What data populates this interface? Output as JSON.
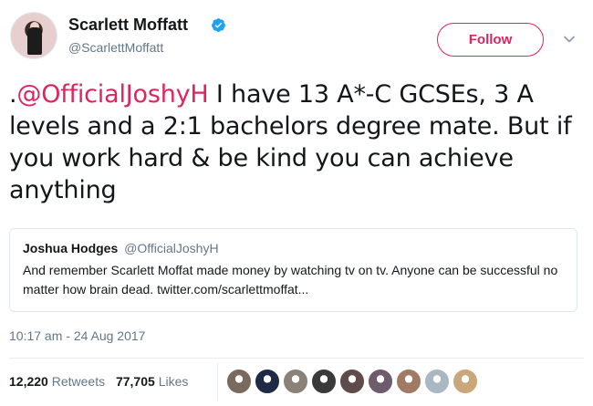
{
  "user": {
    "name": "Scarlett Moffatt",
    "handle": "@ScarlettMoffatt",
    "verified_icon": "verified-badge-icon",
    "avatar_icon": "profile-avatar"
  },
  "actions": {
    "follow_label": "Follow",
    "more_icon": "chevron-down-icon"
  },
  "tweet": {
    "prefix": ".",
    "mention": "@OfficialJoshyH",
    "text": " I have 13 A*-C GCSEs, 3 A levels and a 2:1 bachelors degree mate. But if you work hard & be kind you can achieve anything"
  },
  "quoted": {
    "name": "Joshua Hodges",
    "handle": "@OfficialJoshyH",
    "text": "And remember Scarlett Moffat made money by watching tv on tv. Anyone can be successful no matter how brain dead. twitter.com/scarlettmoffat..."
  },
  "timestamp": "10:17 am - 24 Aug 2017",
  "stats": {
    "retweets_count": "12,220",
    "retweets_label": "Retweets",
    "likes_count": "77,705",
    "likes_label": "Likes"
  },
  "colors": {
    "accent": "#e0245e",
    "verified": "#1da1f2",
    "secondary_text": "#657786"
  },
  "likers": [
    {
      "name": "liker-avatar-1",
      "color": "#7a6a5e"
    },
    {
      "name": "liker-avatar-2",
      "color": "#1f2a44"
    },
    {
      "name": "liker-avatar-3",
      "color": "#8a8178"
    },
    {
      "name": "liker-avatar-4",
      "color": "#3b3a3a"
    },
    {
      "name": "liker-avatar-5",
      "color": "#5d4c4a"
    },
    {
      "name": "liker-avatar-6",
      "color": "#6e5c6c"
    },
    {
      "name": "liker-avatar-7",
      "color": "#a07a62"
    },
    {
      "name": "liker-avatar-8",
      "color": "#aab8c2"
    },
    {
      "name": "liker-avatar-9",
      "color": "#c9a77a"
    }
  ]
}
